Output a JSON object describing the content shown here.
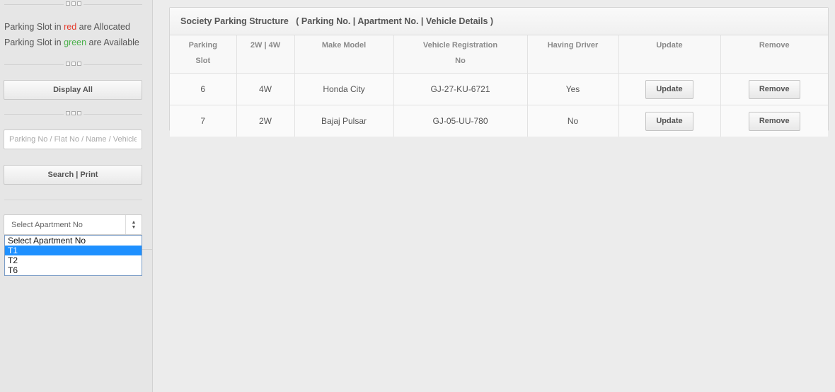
{
  "sidebar": {
    "legend_allocated": {
      "prefix": "Parking Slot in ",
      "color_word": "red",
      "suffix": " are Allocated"
    },
    "legend_available": {
      "prefix": "Parking Slot in ",
      "color_word": "green",
      "suffix": " are Available"
    },
    "display_all_label": "Display All",
    "search_placeholder": "Parking No / Flat No / Name / Vehicle",
    "search_print_label": "Search | Print",
    "apartment_select": {
      "selected_text": "Select Apartment No",
      "options": [
        "Select Apartment No",
        "T1",
        "T2",
        "T6"
      ],
      "highlighted": "T1"
    }
  },
  "panel": {
    "title": "Society Parking Structure   ( Parking No. | Apartment No. | Vehicle Details )",
    "columns": {
      "slot_line1": "Parking",
      "slot_line2": "Slot",
      "wheels": "2W | 4W",
      "make_model": "Make Model",
      "reg_line1": "Vehicle Registration",
      "reg_line2": "No",
      "driver": "Having Driver",
      "update": "Update",
      "remove": "Remove"
    },
    "rows": [
      {
        "slot": "6",
        "wheels": "4W",
        "make_model": "Honda City",
        "registration": "GJ-27-KU-6721",
        "driver": "Yes",
        "update_label": "Update",
        "remove_label": "Remove"
      },
      {
        "slot": "7",
        "wheels": "2W",
        "make_model": "Bajaj Pulsar",
        "registration": "GJ-05-UU-780",
        "driver": "No",
        "update_label": "Update",
        "remove_label": "Remove"
      }
    ]
  },
  "colors": {
    "allocated": "#e53b2c",
    "available": "#4bb14b",
    "dropdown_highlight": "#1e90ff"
  }
}
